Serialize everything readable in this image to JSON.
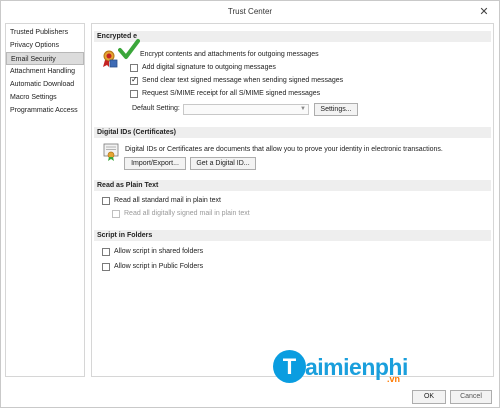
{
  "window": {
    "title": "Trust Center",
    "close_glyph": "✕"
  },
  "sidebar": {
    "items": [
      {
        "label": "Trusted Publishers",
        "active": false
      },
      {
        "label": "Privacy Options",
        "active": false
      },
      {
        "label": "Email Security",
        "active": true
      },
      {
        "label": "Attachment Handling",
        "active": false
      },
      {
        "label": "Automatic Download",
        "active": false
      },
      {
        "label": "Macro Settings",
        "active": false
      },
      {
        "label": "Programmatic Access",
        "active": false
      }
    ]
  },
  "encrypted": {
    "header": "Encrypted e",
    "options": [
      {
        "label": "Encrypt contents and attachments for outgoing messages",
        "checked": true,
        "disabled": false
      },
      {
        "label": "Add digital signature to outgoing messages",
        "checked": false,
        "disabled": false
      },
      {
        "label": "Send clear text signed message when sending signed messages",
        "checked": true,
        "disabled": false
      },
      {
        "label": "Request S/MIME receipt for all S/MIME signed messages",
        "checked": false,
        "disabled": false
      }
    ],
    "default_setting_label": "Default Setting:",
    "default_setting_value": "",
    "settings_button": "Settings..."
  },
  "digital_ids": {
    "header": "Digital IDs (Certificates)",
    "description": "Digital IDs or Certificates are documents that allow you to prove your identity in electronic transactions.",
    "import_export_button": "Import/Export...",
    "get_id_button": "Get a Digital ID..."
  },
  "plain_text": {
    "header": "Read as Plain Text",
    "options": [
      {
        "label": "Read all standard mail in plain text",
        "checked": false,
        "disabled": false
      },
      {
        "label": "Read all digitally signed mail in plain text",
        "checked": false,
        "disabled": true
      }
    ]
  },
  "script": {
    "header": "Script in Folders",
    "options": [
      {
        "label": "Allow script in shared folders",
        "checked": false,
        "disabled": false
      },
      {
        "label": "Allow script in Public Folders",
        "checked": false,
        "disabled": false
      }
    ]
  },
  "footer": {
    "ok_button": "OK",
    "cancel_button": "Cancel"
  },
  "watermark": {
    "letter": "T",
    "text": "aimienphi",
    "suffix": ".vn"
  },
  "colors": {
    "accent": "#0a9de0",
    "checkmark_green": "#3aa63a",
    "watermark_orange": "#ff7a00"
  },
  "icons": [
    "close-icon",
    "certificate-ribbon-icon",
    "green-checkmark-icon",
    "digital-id-certificate-icon",
    "dropdown-arrow-icon"
  ]
}
